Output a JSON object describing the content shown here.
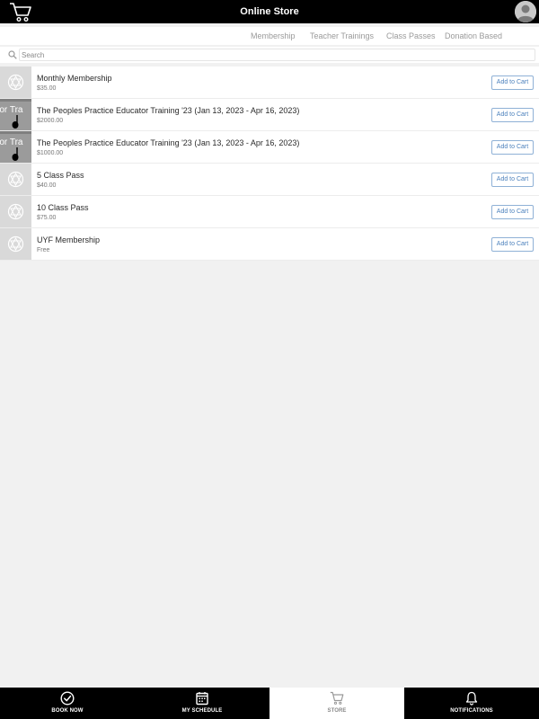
{
  "header": {
    "title": "Online Store"
  },
  "tabs": [
    {
      "label": "Membership"
    },
    {
      "label": "Teacher Trainings"
    },
    {
      "label": "Class Passes"
    },
    {
      "label": "Donation Based"
    }
  ],
  "search": {
    "placeholder": "Search",
    "value": ""
  },
  "products": [
    {
      "name": "Monthly Membership",
      "price": "$35.00",
      "thumb": "logo",
      "action": "Add to Cart"
    },
    {
      "name": "The Peoples Practice Educator Training '23 (Jan 13, 2023 - Apr 16, 2023)",
      "price": "$2000.00",
      "thumb": "photo",
      "thumb_text": "ator Tra",
      "action": "Add to Cart"
    },
    {
      "name": "The Peoples Practice Educator Training '23 (Jan 13, 2023 - Apr 16, 2023)",
      "price": "$1000.00",
      "thumb": "photo",
      "thumb_text": "ator Tra",
      "action": "Add to Cart"
    },
    {
      "name": "5 Class Pass",
      "price": "$40.00",
      "thumb": "logo",
      "action": "Add to Cart"
    },
    {
      "name": "10 Class Pass",
      "price": "$75.00",
      "thumb": "logo",
      "action": "Add to Cart"
    },
    {
      "name": "UYF Membership",
      "price": "Free",
      "thumb": "logo",
      "action": "Add to Cart"
    }
  ],
  "bottom_nav": [
    {
      "label": "BOOK NOW",
      "icon": "check-circle-icon",
      "active": false
    },
    {
      "label": "MY SCHEDULE",
      "icon": "calendar-icon",
      "active": false
    },
    {
      "label": "STORE",
      "icon": "cart-icon",
      "active": true
    },
    {
      "label": "NOTIFICATIONS",
      "icon": "bell-icon",
      "active": false
    }
  ],
  "colors": {
    "header_bg": "#000000",
    "accent_button": "#4d82bd",
    "tab_text": "#9a9a9a",
    "page_bg": "#f1f1f1"
  }
}
